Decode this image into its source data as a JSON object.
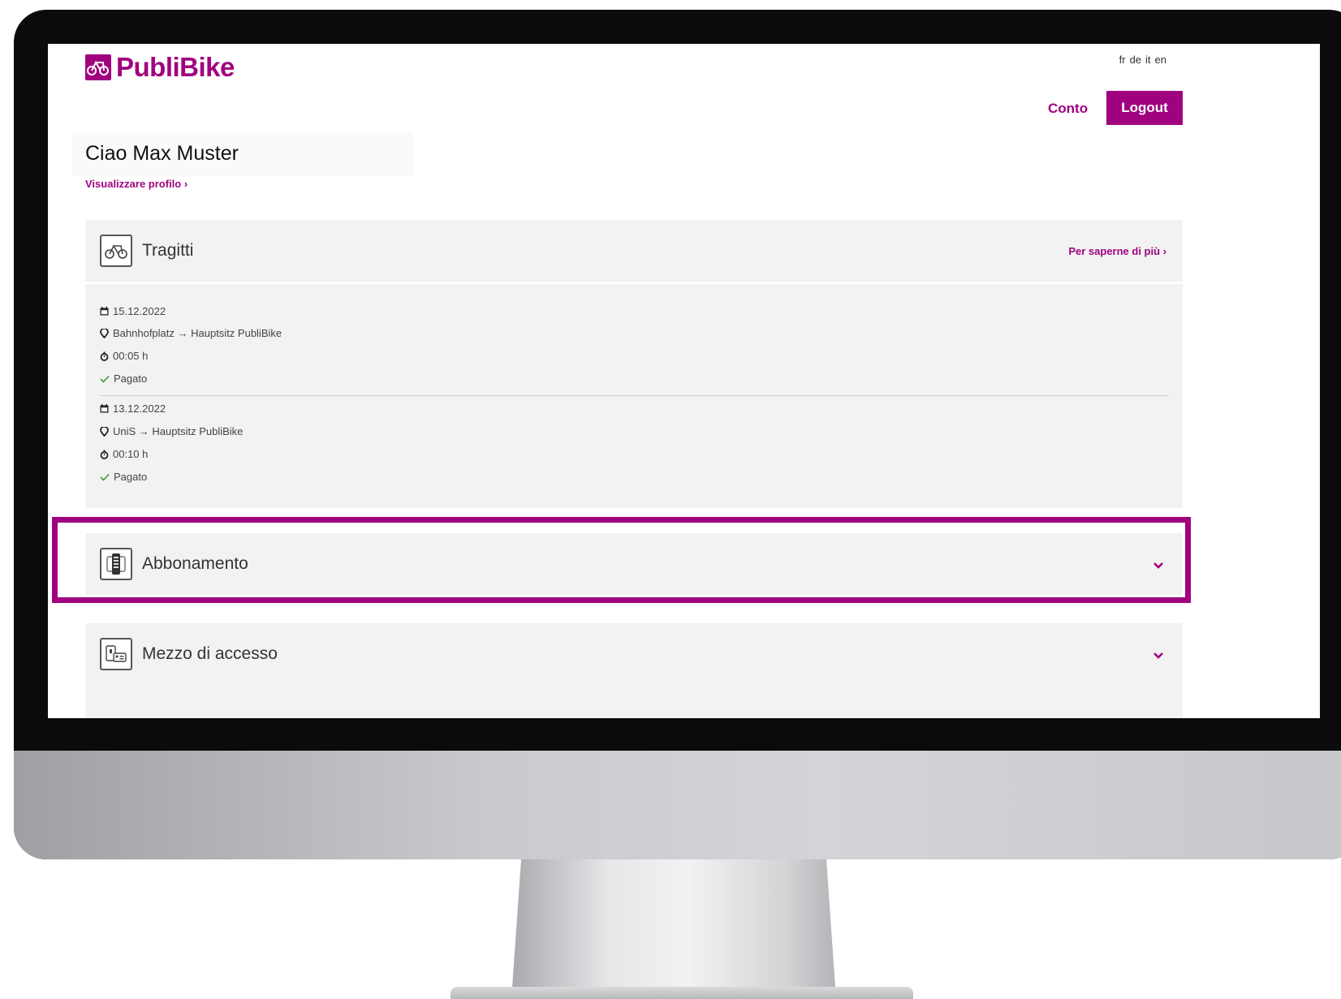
{
  "brand": {
    "name": "PubliBike",
    "color": "#a0027f"
  },
  "languages": [
    "fr",
    "de",
    "it",
    "en"
  ],
  "nav": {
    "account_label": "Conto",
    "logout_label": "Logout"
  },
  "greeting": "Ciao Max Muster",
  "profile_link": "Visualizzare profilo ›",
  "sections": {
    "trips": {
      "title": "Tragitti",
      "icon": "bike-icon",
      "more_link": "Per saperne di più ›",
      "items": [
        {
          "date": "15.12.2022",
          "route": "Bahnhofplatz → Hauptsitz PubliBike",
          "duration": "00:05 h",
          "status": "Pagato"
        },
        {
          "date": "13.12.2022",
          "route": "UniS → Hauptsitz PubliBike",
          "duration": "00:10 h",
          "status": "Pagato"
        }
      ]
    },
    "subscription": {
      "title": "Abbonamento",
      "icon": "subscription-card-icon",
      "expanded": false
    },
    "access": {
      "title": "Mezzo di accesso",
      "icon": "access-card-icon",
      "expanded": false
    }
  }
}
